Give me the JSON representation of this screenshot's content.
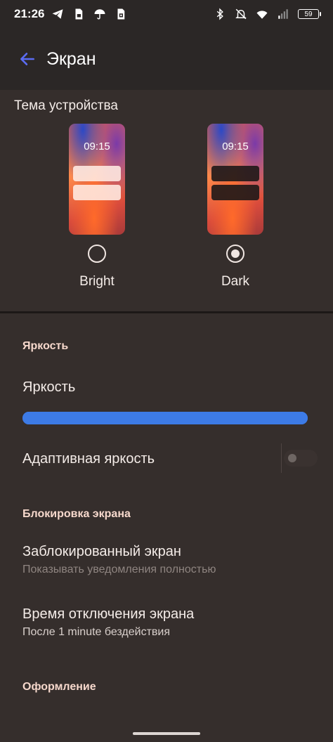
{
  "status_bar": {
    "time": "21:26",
    "battery": "59",
    "left_icons": [
      "telegram-icon",
      "sim-icon",
      "umbrella-icon",
      "sim-card-icon"
    ],
    "right_icons": [
      "bluetooth-icon",
      "bell-off-icon",
      "wifi-3g-icon",
      "signal-icon"
    ]
  },
  "app_bar": {
    "title": "Экран"
  },
  "theme": {
    "title": "Тема устройства",
    "options": [
      {
        "label": "Bright",
        "time": "09:15",
        "selected": false
      },
      {
        "label": "Dark",
        "time": "09:15",
        "selected": true
      }
    ]
  },
  "brightness": {
    "header": "Яркость",
    "label": "Яркость",
    "level_fraction": 1.0,
    "accent": "#3d7be6",
    "adaptive_label": "Адаптивная яркость",
    "adaptive_enabled": false
  },
  "lock_screen": {
    "header": "Блокировка экрана",
    "locked_title": "Заблокированный экран",
    "locked_sub": "Показывать уведомления полностью",
    "timeout_title": "Время отключения экрана",
    "timeout_sub": "После 1 minute бездействия"
  },
  "appearance": {
    "header": "Оформление"
  }
}
